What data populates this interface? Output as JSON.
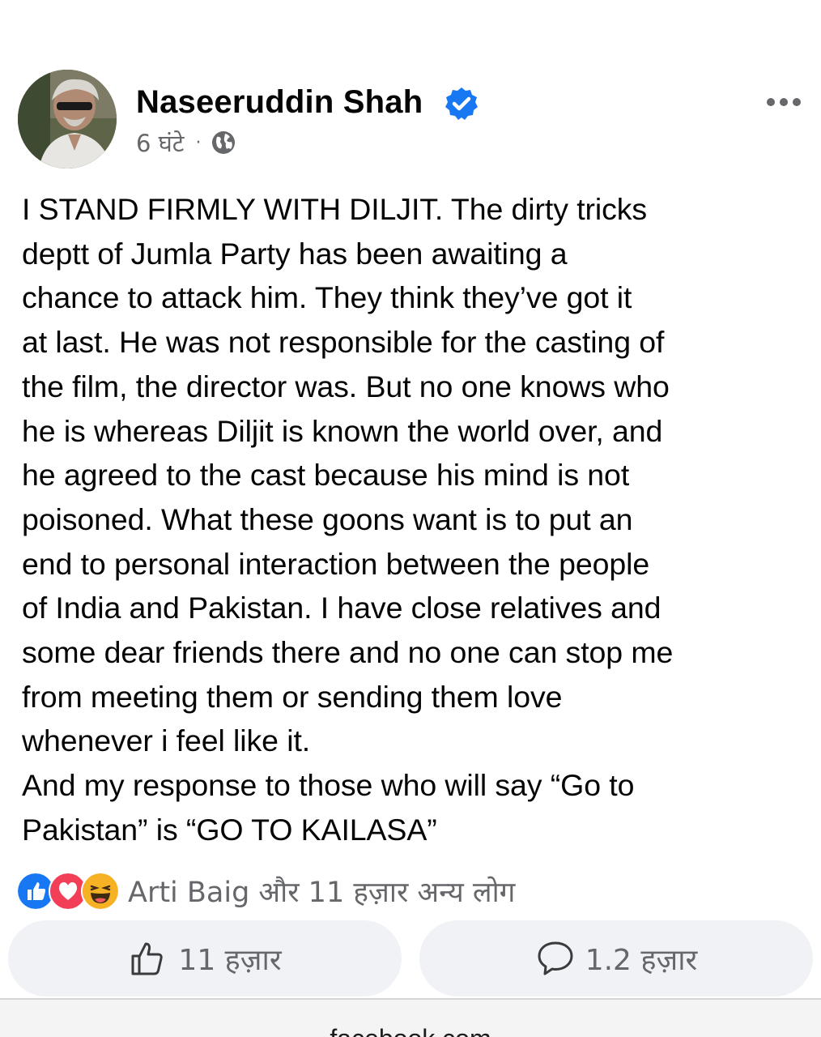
{
  "post": {
    "author": "Naseeruddin Shah",
    "time": "6 घंटे",
    "meta_separator": "·",
    "body": "I STAND FIRMLY WITH DILJIT. The dirty tricks\ndeptt of Jumla Party has been awaiting a\nchance to attack him. They think they’ve got it\nat last. He was not responsible for the casting of\nthe film, the director was. But no one knows who\nhe is whereas Diljit is known the world over, and\nhe agreed to the cast because his mind is not\npoisoned. What these goons want is to put an\nend to personal interaction between the people\nof India and Pakistan. I have close relatives and\nsome dear friends there and no one can stop me\nfrom meeting them or sending them love\nwhenever i feel like it.\nAnd my response to  those who will say “Go to\nPakistan” is “GO TO KAILASA”"
  },
  "reactions": {
    "summary": "Arti Baig और 11 हज़ार अन्य लोग",
    "types": [
      "like-icon",
      "love-icon",
      "haha-icon"
    ]
  },
  "actions": {
    "like_count": "11 हज़ार",
    "comment_count": "1.2 हज़ार"
  },
  "footer": {
    "url": "facebook.com"
  },
  "icons": {
    "verified": "verified-badge-icon",
    "audience": "globe-icon",
    "more": "more-options-icon",
    "like": "thumbs-up-icon",
    "comment": "comment-bubble-icon"
  },
  "colors": {
    "verified_blue": "#1877f2",
    "like_blue": "#1877f2",
    "love_red": "#f33e58",
    "haha_yellow": "#f7b125",
    "secondary_text": "#65676b",
    "button_bg": "#f0f2f5"
  }
}
